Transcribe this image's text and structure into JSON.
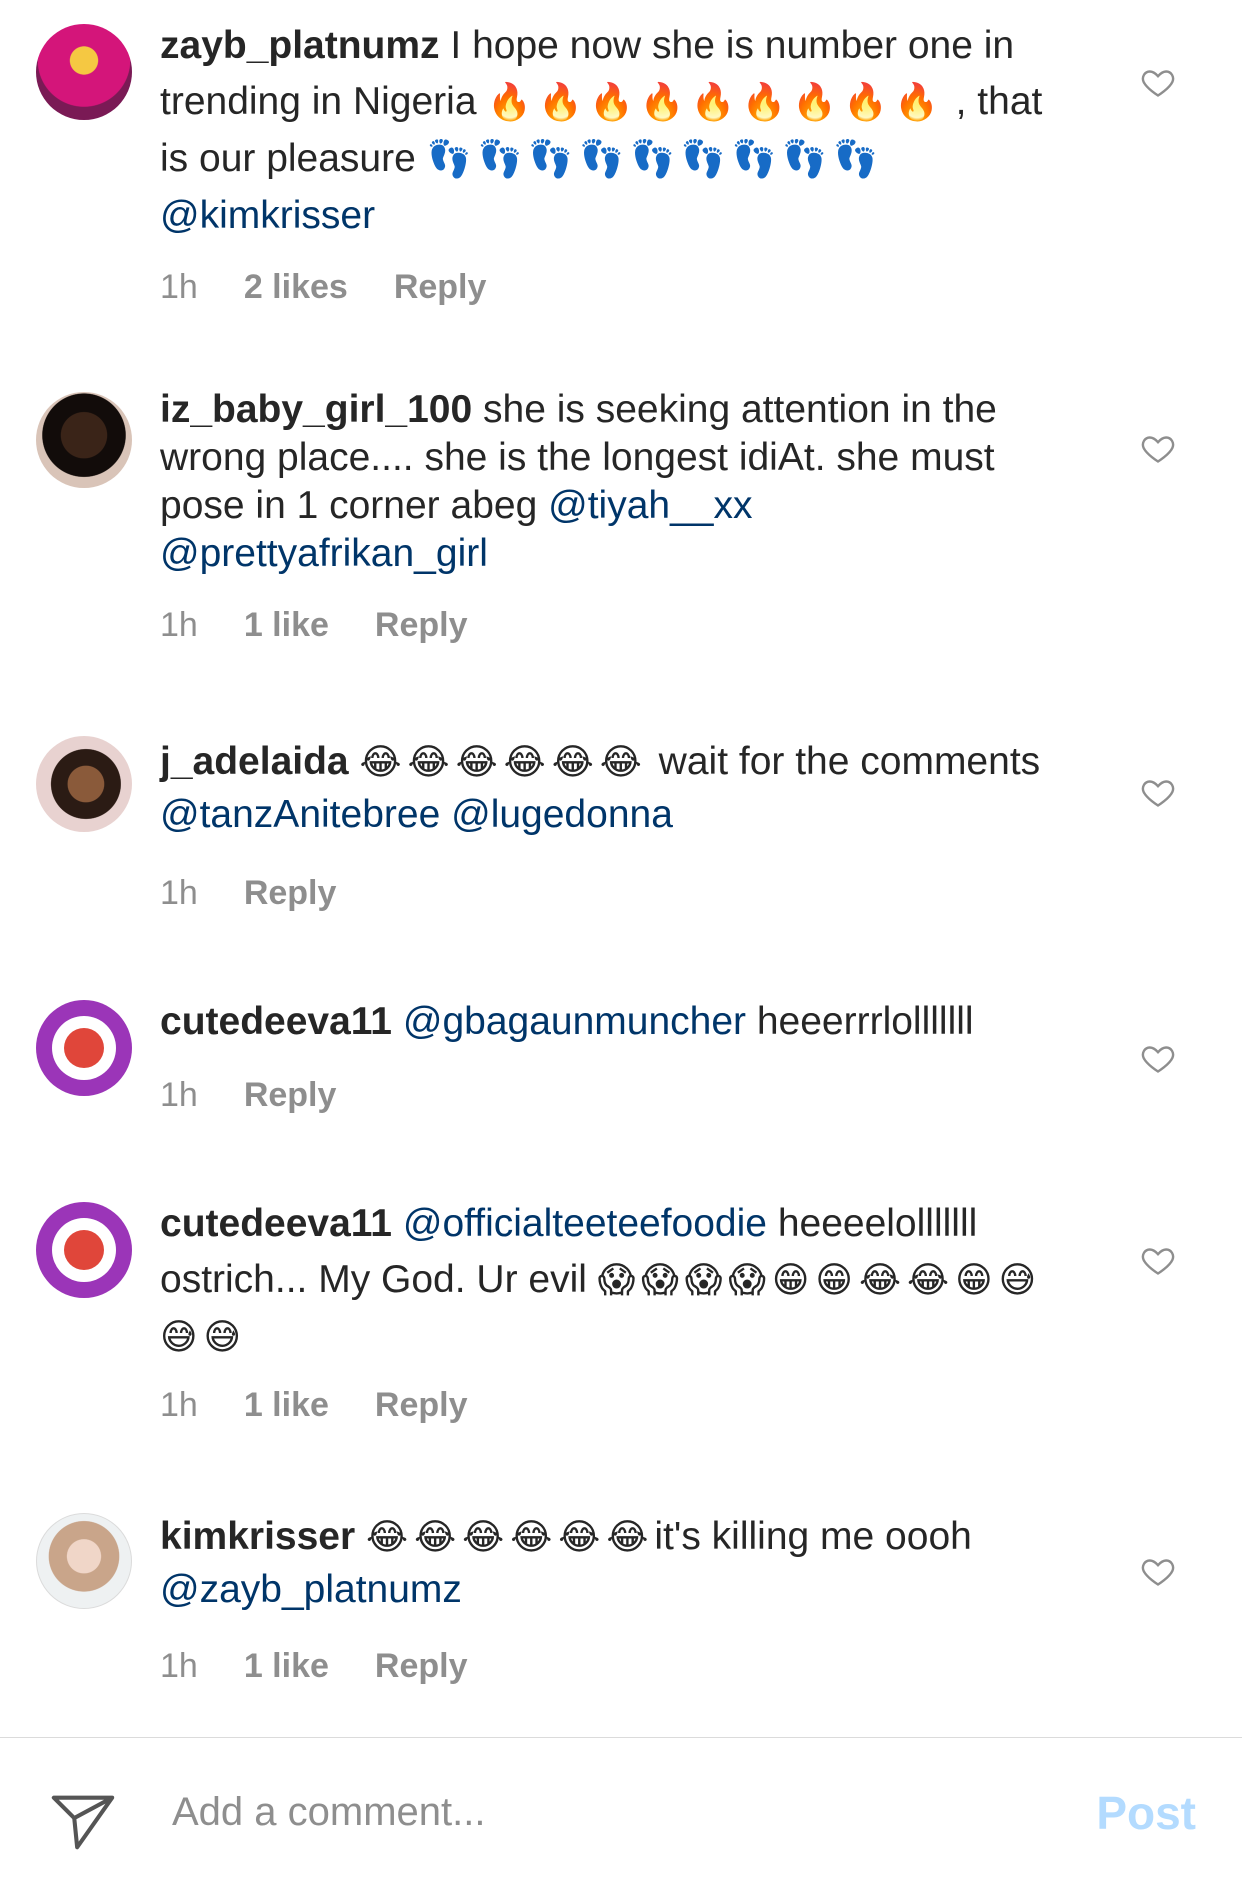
{
  "comments": [
    {
      "user": "zayb_platnumz",
      "text1": " I hope now she is number one in trending in Nigeria ",
      "emoji1": "🔥🔥🔥🔥🔥🔥🔥🔥🔥",
      "text2": " , that is our pleasure ",
      "emoji2": "👣👣👣👣👣👣👣👣👣",
      "mention1": "@kimkrisser",
      "time": "1h",
      "likes": "2 likes",
      "reply": "Reply"
    },
    {
      "user": "iz_baby_girl_100",
      "text1": " she is seeking attention in the wrong place.... she is the longest idiAt. she must pose in 1 corner abeg ",
      "mention1": "@tiyah__xx",
      "mention2": "@prettyafrikan_girl",
      "time": "1h",
      "likes": "1 like",
      "reply": "Reply"
    },
    {
      "user": "j_adelaida",
      "emoji1": "😂😂😂😂😂😂",
      "text1": "  wait for the comments ",
      "mention1": "@tanzAnitebree",
      "mention2": "@lugedonna",
      "time": "1h",
      "reply": "Reply"
    },
    {
      "user": "cutedeeva11",
      "mention1": "@gbagaunmuncher",
      "text1": " heeerrrlolllllll",
      "time": "1h",
      "reply": "Reply"
    },
    {
      "user": "cutedeeva11",
      "mention1": "@officialteeteefoodie",
      "text1": " heeeelolllllll ostrich... My God.  Ur evil ",
      "emoji1": "😱😱😱😱😁😁😂😂😁😅😅😅",
      "time": "1h",
      "likes": "1 like",
      "reply": "Reply"
    },
    {
      "user": "kimkrisser",
      "emoji1": "😂😂😂😂😂😂",
      "text1": "it's killing me oooh ",
      "mention1": "@zayb_platnumz",
      "time": "1h",
      "likes": "1 like",
      "reply": "Reply"
    }
  ],
  "composer": {
    "placeholder": "Add a comment...",
    "post_label": "Post"
  },
  "colors": {
    "mention": "#003569",
    "meta": "#8e8e8e",
    "post": "#b3dbff"
  }
}
